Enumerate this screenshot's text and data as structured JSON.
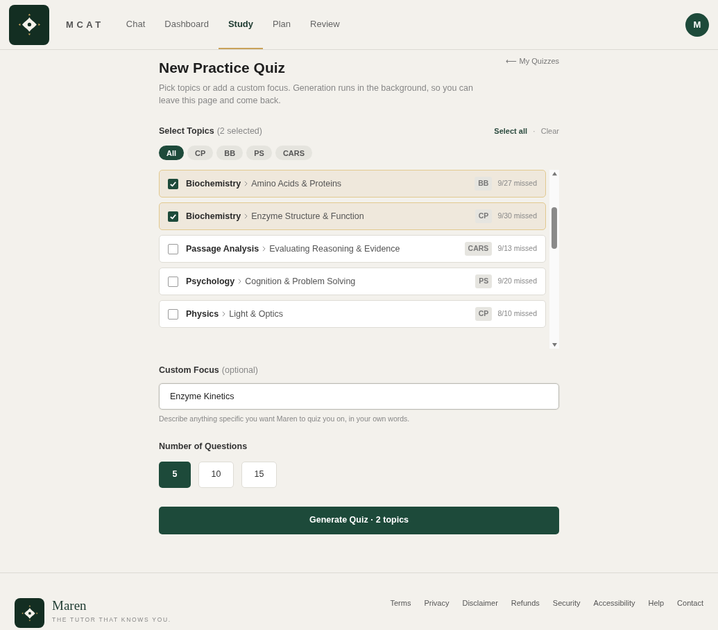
{
  "header": {
    "brand": "MCAT",
    "nav": [
      {
        "label": "Chat",
        "selected": false
      },
      {
        "label": "Dashboard",
        "selected": false
      },
      {
        "label": "Study",
        "selected": true
      },
      {
        "label": "Plan",
        "selected": false
      },
      {
        "label": "Review",
        "selected": false
      }
    ],
    "avatar": "M"
  },
  "page": {
    "back_link": "⟵ My Quizzes",
    "title": "New Practice Quiz",
    "subtitle": "Pick topics or add a custom focus. Generation runs in the background, so you can leave this page and come back."
  },
  "topics": {
    "label": "Select Topics",
    "count": "(2 selected)",
    "select_all": "Select all",
    "separator": "·",
    "clear": "Clear",
    "filters": [
      {
        "label": "All",
        "selected": true
      },
      {
        "label": "CP",
        "selected": false
      },
      {
        "label": "BB",
        "selected": false
      },
      {
        "label": "PS",
        "selected": false
      },
      {
        "label": "CARS",
        "selected": false
      }
    ],
    "items": [
      {
        "subject": "Biochemistry",
        "topic": "Amino Acids & Proteins",
        "tag": "BB",
        "missed": "9/27 missed",
        "checked": true
      },
      {
        "subject": "Biochemistry",
        "topic": "Enzyme Structure & Function",
        "tag": "CP",
        "missed": "9/30 missed",
        "checked": true
      },
      {
        "subject": "Passage Analysis",
        "topic": "Evaluating Reasoning & Evidence",
        "tag": "CARS",
        "missed": "9/13 missed",
        "checked": false
      },
      {
        "subject": "Psychology",
        "topic": "Cognition & Problem Solving",
        "tag": "PS",
        "missed": "9/20 missed",
        "checked": false
      },
      {
        "subject": "Physics",
        "topic": "Light & Optics",
        "tag": "CP",
        "missed": "8/10 missed",
        "checked": false
      }
    ]
  },
  "custom_focus": {
    "label": "Custom Focus",
    "optional": "(optional)",
    "value": "Enzyme Kinetics",
    "hint": "Describe anything specific you want Maren to quiz you on, in your own words."
  },
  "questions": {
    "label": "Number of Questions",
    "options": [
      {
        "label": "5",
        "selected": true
      },
      {
        "label": "10",
        "selected": false
      },
      {
        "label": "15",
        "selected": false
      }
    ]
  },
  "generate_button": "Generate Quiz · 2 topics",
  "footer": {
    "brand": "Maren",
    "tagline": "THE TUTOR THAT KNOWS YOU.",
    "links": [
      "Terms",
      "Privacy",
      "Disclaimer",
      "Refunds",
      "Security",
      "Accessibility",
      "Help",
      "Contact"
    ]
  }
}
